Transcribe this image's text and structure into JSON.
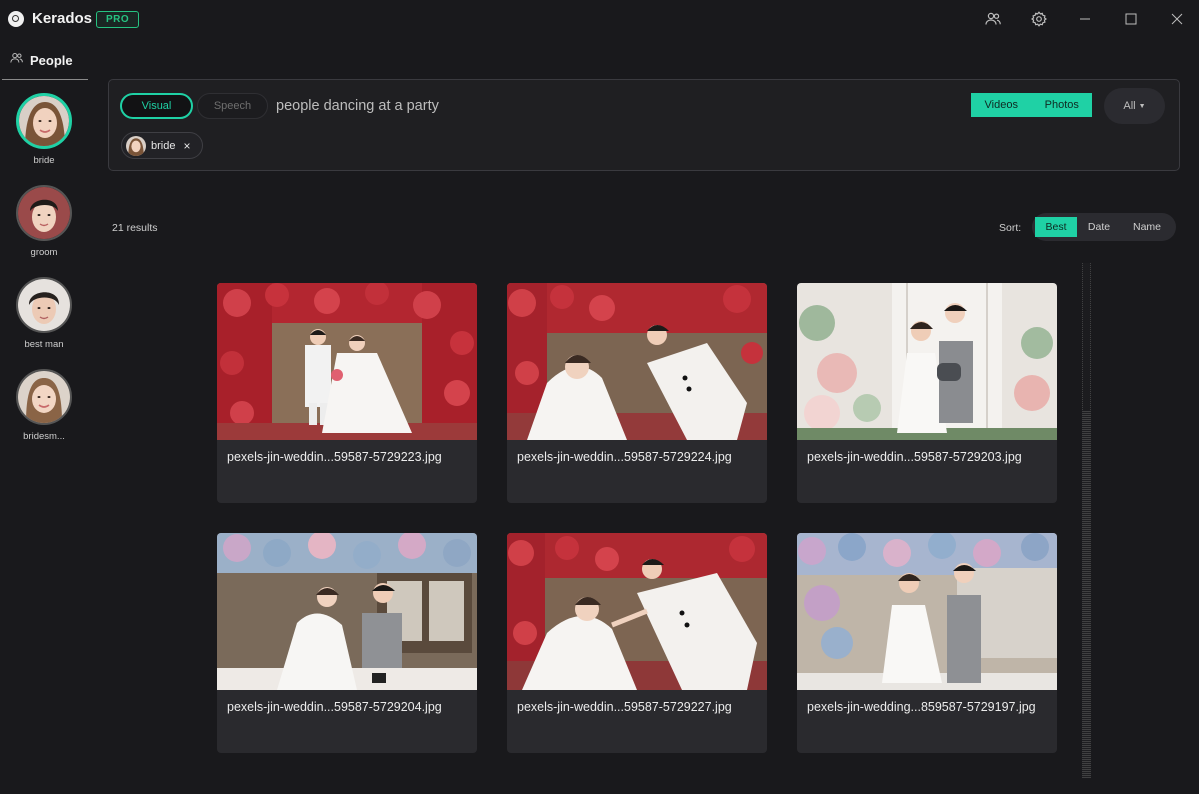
{
  "app": {
    "title": "Kerados",
    "badge": "PRO"
  },
  "titlebar": {
    "icons": [
      "people-icon",
      "gear-icon",
      "minimize-icon",
      "maximize-icon",
      "close-icon"
    ]
  },
  "sidebar": {
    "header": "People",
    "people": [
      {
        "name": "bride",
        "selected": true
      },
      {
        "name": "groom",
        "selected": false
      },
      {
        "name": "best man",
        "selected": false
      },
      {
        "name": "bridesm...",
        "selected": false
      }
    ]
  },
  "search": {
    "modes": {
      "visual": "Visual",
      "speech": "Speech"
    },
    "query": "people dancing at a party",
    "types": {
      "videos": "Videos",
      "photos": "Photos"
    },
    "filter": "All",
    "chip": {
      "label": "bride",
      "close": "×"
    }
  },
  "results": {
    "count": "21 results",
    "sort_label": "Sort:",
    "sort_options": {
      "best": "Best",
      "date": "Date",
      "name": "Name"
    },
    "items": [
      {
        "filename": "pexels-jin-weddin...59587-5729223.jpg"
      },
      {
        "filename": "pexels-jin-weddin...59587-5729224.jpg"
      },
      {
        "filename": "pexels-jin-weddin...59587-5729203.jpg"
      },
      {
        "filename": "pexels-jin-weddin...59587-5729204.jpg"
      },
      {
        "filename": "pexels-jin-weddin...59587-5729227.jpg"
      },
      {
        "filename": "pexels-jin-wedding...859587-5729197.jpg"
      }
    ]
  },
  "colors": {
    "accent": "#1fd1a5",
    "pro_badge": "#26c281",
    "background": "#19191c",
    "card": "#2a2a2e"
  }
}
